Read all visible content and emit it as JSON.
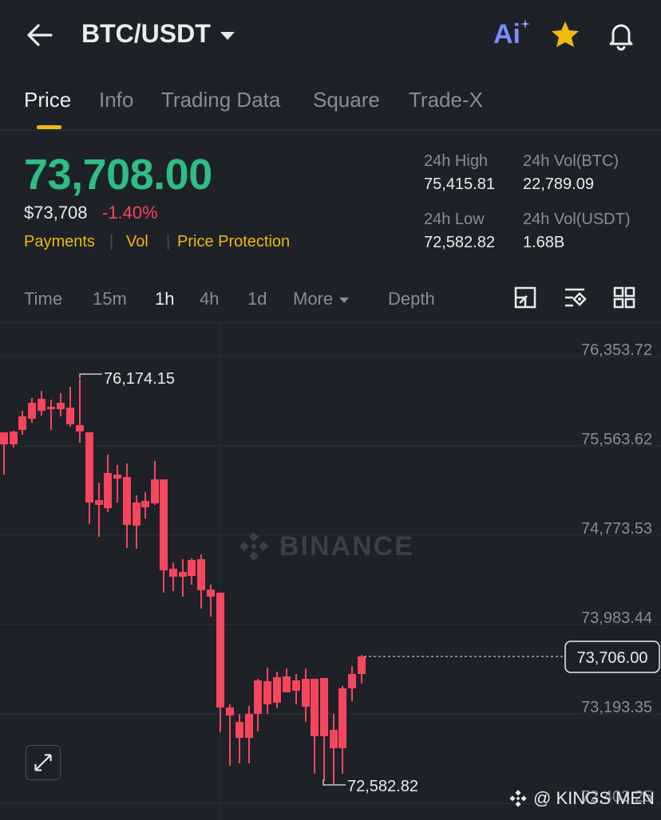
{
  "header": {
    "pair": "BTC/USDT",
    "icons": [
      "back-arrow-icon",
      "ai-icon",
      "star-icon",
      "bell-icon"
    ],
    "ai_label": "Ai"
  },
  "tabs": [
    {
      "label": "Price",
      "active": true
    },
    {
      "label": "Info"
    },
    {
      "label": "Trading Data"
    },
    {
      "label": "Square"
    },
    {
      "label": "Trade-X"
    }
  ],
  "price": {
    "last": "73,708.00",
    "fiat": "$73,708",
    "change": "-1.40%",
    "links": [
      "Payments",
      "Vol",
      "Price Protection"
    ]
  },
  "stats": {
    "high_label": "24h High",
    "high_value": "75,415.81",
    "vol_btc_label": "24h Vol(BTC)",
    "vol_btc_value": "22,789.09",
    "low_label": "24h Low",
    "low_value": "72,582.82",
    "vol_usdt_label": "24h Vol(USDT)",
    "vol_usdt_value": "1.68B"
  },
  "intervals": [
    {
      "label": "Time"
    },
    {
      "label": "15m"
    },
    {
      "label": "1h",
      "active": true
    },
    {
      "label": "4h"
    },
    {
      "label": "1d"
    },
    {
      "label": "More"
    },
    {
      "label": "Depth"
    }
  ],
  "chart_data": {
    "type": "candlestick",
    "y_ticks": [
      "76,353.72",
      "75,563.62",
      "74,773.53",
      "73,983.44",
      "73,193.35",
      "72,403.25"
    ],
    "high_marker": "76,174.15",
    "low_marker": "72,582.82",
    "current_price_label": "73,706.00",
    "watermark": "BINANCE",
    "colors": {
      "up": "#2ebd85",
      "down": "#f6465d"
    }
  },
  "footer": {
    "credit": "@ KINGS MEN"
  }
}
